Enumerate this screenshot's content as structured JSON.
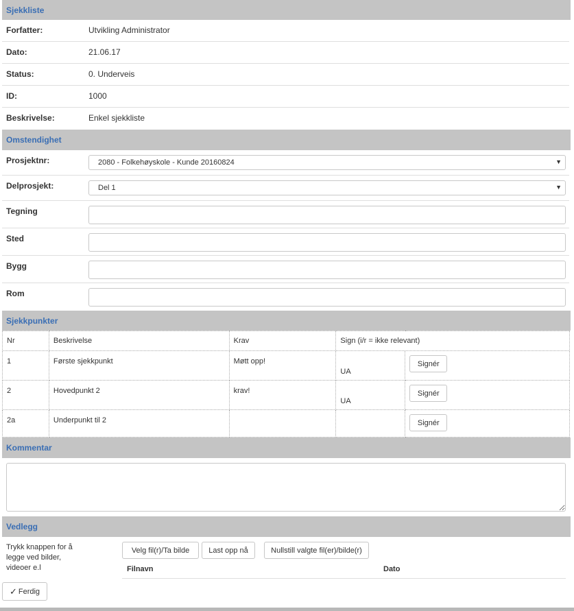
{
  "checklist": {
    "title": "Sjekkliste",
    "fields": [
      {
        "label": "Forfatter:",
        "value": "Utvikling Administrator"
      },
      {
        "label": "Dato:",
        "value": "21.06.17"
      },
      {
        "label": "Status:",
        "value": "0. Underveis"
      },
      {
        "label": "ID:",
        "value": "1000"
      },
      {
        "label": "Beskrivelse:",
        "value": "Enkel sjekkliste"
      }
    ]
  },
  "omstendighet": {
    "title": "Omstendighet",
    "project_label": "Prosjektnr:",
    "project_value": "2080 - Folkehøyskole - Kunde 20160824",
    "subproject_label": "Delprosjekt:",
    "subproject_value": "Del 1",
    "drawing_label": "Tegning",
    "place_label": "Sted",
    "building_label": "Bygg",
    "room_label": "Rom"
  },
  "sjekkpunkter": {
    "title": "Sjekkpunkter",
    "headers": {
      "nr": "Nr",
      "beskrivelse": "Beskrivelse",
      "krav": "Krav",
      "sign": "Sign (i/r = ikke relevant)"
    },
    "rows": [
      {
        "nr": "1",
        "beskrivelse": "Første sjekkpunkt",
        "krav": "Møtt opp!",
        "sign": "UA",
        "button": "Signér"
      },
      {
        "nr": "2",
        "beskrivelse": "Hovedpunkt 2",
        "krav": "krav!",
        "sign": "UA",
        "button": "Signér"
      },
      {
        "nr": "2a",
        "beskrivelse": "Underpunkt til 2",
        "krav": "",
        "sign": "",
        "button": "Signér"
      }
    ]
  },
  "kommentar": {
    "title": "Kommentar",
    "value": ""
  },
  "vedlegg": {
    "title": "Vedlegg",
    "help": "Trykk knappen for å legge ved bilder, videoer e.l",
    "choose_label": "Velg fil(r)/Ta bilde",
    "upload_label": "Last opp nå",
    "reset_label": "Nullstill valgte fil(er)/bilde(r)",
    "col_filename": "Filnavn",
    "col_date": "Dato"
  },
  "footer": {
    "done_label": "Ferdig"
  }
}
